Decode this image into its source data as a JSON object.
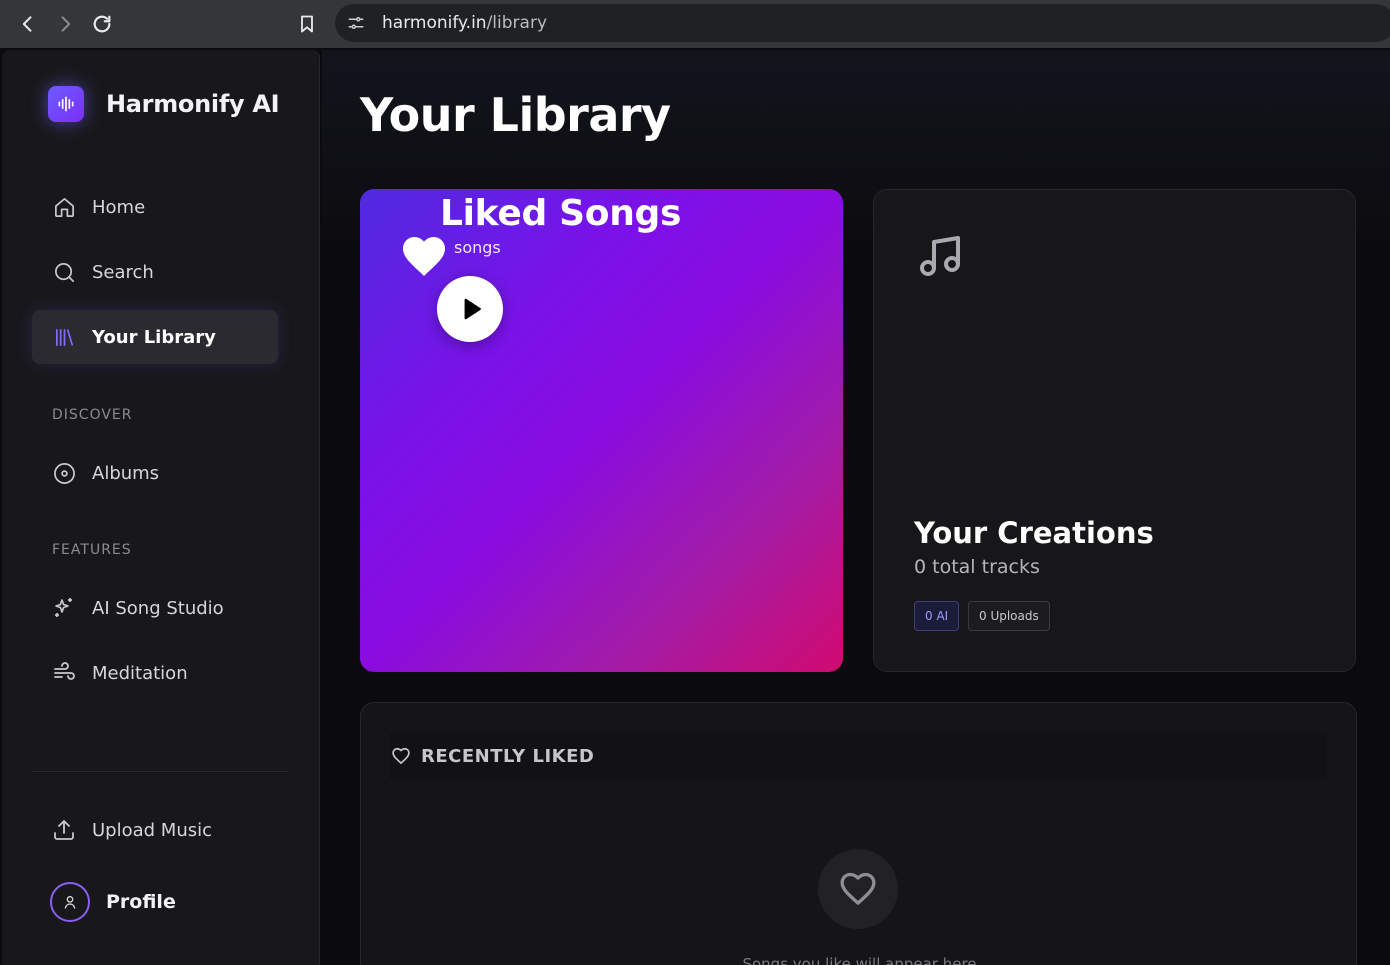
{
  "browser": {
    "url_host": "harmonify.in",
    "url_path": "/library"
  },
  "sidebar": {
    "brand": "Harmonify AI",
    "nav": [
      {
        "label": "Home",
        "icon": "home-icon"
      },
      {
        "label": "Search",
        "icon": "search-icon"
      },
      {
        "label": "Your Library",
        "icon": "library-icon",
        "active": true
      }
    ],
    "discover_label": "DISCOVER",
    "discover": [
      {
        "label": "Albums",
        "icon": "disc-icon"
      }
    ],
    "features_label": "FEATURES",
    "features": [
      {
        "label": "AI Song Studio",
        "icon": "sparkles-icon"
      },
      {
        "label": "Meditation",
        "icon": "wind-icon"
      }
    ],
    "upload_label": "Upload Music",
    "profile_label": "Profile"
  },
  "main": {
    "title": "Your Library",
    "liked": {
      "title": "Liked Songs",
      "count_text": "songs"
    },
    "creations": {
      "title": "Your Creations",
      "subtitle": "0 total tracks",
      "badge_ai": "0 AI",
      "badge_uploads": "0 Uploads"
    },
    "recently_liked": {
      "title": "RECENTLY LIKED",
      "empty_text": "Songs you like will appear here"
    }
  },
  "colors": {
    "accent": "#7c6cff",
    "liked_gradient_start": "#4f2be0",
    "liked_gradient_end": "#d10a70"
  }
}
